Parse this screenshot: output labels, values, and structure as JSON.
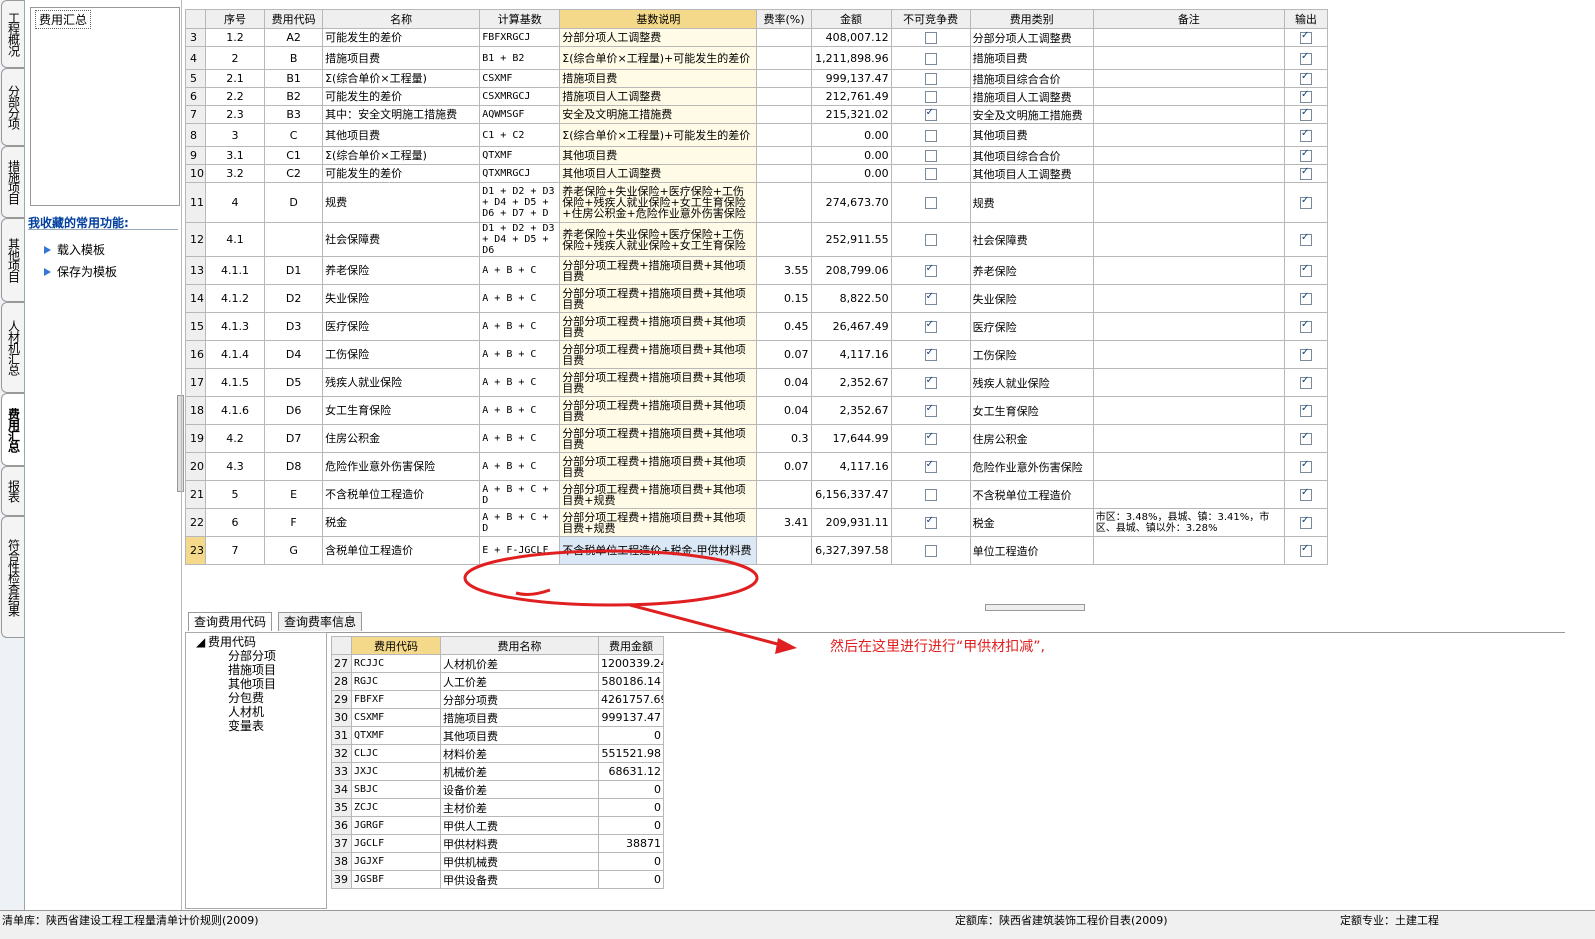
{
  "vertical_tabs": [
    "工程概况",
    "分部分项",
    "措施项目",
    "其他项目",
    "人材机汇总",
    "费用汇总",
    "报表",
    "符合性检查结果"
  ],
  "active_vertical_tab": "费用汇总",
  "nav": {
    "selected": "费用汇总"
  },
  "favorites": {
    "title": "我收藏的常用功能:",
    "items": [
      "载入模板",
      "保存为模板"
    ]
  },
  "grid": {
    "headers": [
      "序号",
      "费用代码",
      "名称",
      "计算基数",
      "基数说明",
      "费率(%)",
      "金额",
      "不可竞争费",
      "费用类别",
      "备注",
      "输出"
    ],
    "rows": [
      {
        "rn": "3",
        "seq": "1.2",
        "code": "A2",
        "name": "可能发生的差价",
        "base": "FBFXRGCJ",
        "note": "分部分项人工调整费",
        "rate": "",
        "amount": "408,007.12",
        "nc": false,
        "cat": "分部分项人工调整费",
        "remark": "",
        "out": true
      },
      {
        "rn": "4",
        "seq": "2",
        "code": "B",
        "name": "措施项目费",
        "base": "B1 + B2",
        "note": "Σ(综合单价×工程量)+可能发生的差价",
        "rate": "",
        "amount": "1,211,898.96",
        "nc": false,
        "cat": "措施项目费",
        "remark": "",
        "out": true
      },
      {
        "rn": "5",
        "seq": "2.1",
        "code": "B1",
        "name": "Σ(综合单价×工程量)",
        "base": "CSXMF",
        "note": "措施项目费",
        "rate": "",
        "amount": "999,137.47",
        "nc": false,
        "cat": "措施项目综合合价",
        "remark": "",
        "out": true
      },
      {
        "rn": "6",
        "seq": "2.2",
        "code": "B2",
        "name": "可能发生的差价",
        "base": "CSXMRGCJ",
        "note": "措施项目人工调整费",
        "rate": "",
        "amount": "212,761.49",
        "nc": false,
        "cat": "措施项目人工调整费",
        "remark": "",
        "out": true
      },
      {
        "rn": "7",
        "seq": "2.3",
        "code": "B3",
        "name": "其中：安全文明施工措施费",
        "base": "AQWMSGF",
        "note": "安全及文明施工措施费",
        "rate": "",
        "amount": "215,321.02",
        "nc": true,
        "cat": "安全及文明施工措施费",
        "remark": "",
        "out": true
      },
      {
        "rn": "8",
        "seq": "3",
        "code": "C",
        "name": "其他项目费",
        "base": "C1 + C2",
        "note": "Σ(综合单价×工程量)+可能发生的差价",
        "rate": "",
        "amount": "0.00",
        "nc": false,
        "cat": "其他项目费",
        "remark": "",
        "out": true
      },
      {
        "rn": "9",
        "seq": "3.1",
        "code": "C1",
        "name": "Σ(综合单价×工程量)",
        "base": "QTXMF",
        "note": "其他项目费",
        "rate": "",
        "amount": "0.00",
        "nc": false,
        "cat": "其他项目综合合价",
        "remark": "",
        "out": true
      },
      {
        "rn": "10",
        "seq": "3.2",
        "code": "C2",
        "name": "可能发生的差价",
        "base": "QTXMRGCJ",
        "note": "其他项目人工调整费",
        "rate": "",
        "amount": "0.00",
        "nc": false,
        "cat": "其他项目人工调整费",
        "remark": "",
        "out": true
      },
      {
        "rn": "11",
        "seq": "4",
        "code": "D",
        "name": "规费",
        "base": "D1 + D2 + D3 + D4 + D5 + D6 + D7 + D",
        "note": "养老保险+失业保险+医疗保险+工伤保险+残疾人就业保险+女工生育保险+住房公积金+危险作业意外伤害保险",
        "rate": "",
        "amount": "274,673.70",
        "nc": false,
        "cat": "规费",
        "remark": "",
        "out": true
      },
      {
        "rn": "12",
        "seq": "4.1",
        "code": "",
        "name": "社会保障费",
        "base": "D1 + D2 + D3 + D4 + D5 + D6",
        "note": "养老保险+失业保险+医疗保险+工伤保险+残疾人就业保险+女工生育保险",
        "rate": "",
        "amount": "252,911.55",
        "nc": false,
        "cat": "社会保障费",
        "remark": "",
        "out": true
      },
      {
        "rn": "13",
        "seq": "4.1.1",
        "code": "D1",
        "name": "养老保险",
        "base": "A + B + C",
        "note": "分部分项工程费+措施项目费+其他项目费",
        "rate": "3.55",
        "amount": "208,799.06",
        "nc": true,
        "cat": "养老保险",
        "remark": "",
        "out": true
      },
      {
        "rn": "14",
        "seq": "4.1.2",
        "code": "D2",
        "name": "失业保险",
        "base": "A + B + C",
        "note": "分部分项工程费+措施项目费+其他项目费",
        "rate": "0.15",
        "amount": "8,822.50",
        "nc": true,
        "cat": "失业保险",
        "remark": "",
        "out": true
      },
      {
        "rn": "15",
        "seq": "4.1.3",
        "code": "D3",
        "name": "医疗保险",
        "base": "A + B + C",
        "note": "分部分项工程费+措施项目费+其他项目费",
        "rate": "0.45",
        "amount": "26,467.49",
        "nc": true,
        "cat": "医疗保险",
        "remark": "",
        "out": true
      },
      {
        "rn": "16",
        "seq": "4.1.4",
        "code": "D4",
        "name": "工伤保险",
        "base": "A + B + C",
        "note": "分部分项工程费+措施项目费+其他项目费",
        "rate": "0.07",
        "amount": "4,117.16",
        "nc": true,
        "cat": "工伤保险",
        "remark": "",
        "out": true
      },
      {
        "rn": "17",
        "seq": "4.1.5",
        "code": "D5",
        "name": "残疾人就业保险",
        "base": "A + B + C",
        "note": "分部分项工程费+措施项目费+其他项目费",
        "rate": "0.04",
        "amount": "2,352.67",
        "nc": true,
        "cat": "残疾人就业保险",
        "remark": "",
        "out": true
      },
      {
        "rn": "18",
        "seq": "4.1.6",
        "code": "D6",
        "name": "女工生育保险",
        "base": "A + B + C",
        "note": "分部分项工程费+措施项目费+其他项目费",
        "rate": "0.04",
        "amount": "2,352.67",
        "nc": true,
        "cat": "女工生育保险",
        "remark": "",
        "out": true
      },
      {
        "rn": "19",
        "seq": "4.2",
        "code": "D7",
        "name": "住房公积金",
        "base": "A + B + C",
        "note": "分部分项工程费+措施项目费+其他项目费",
        "rate": "0.3",
        "amount": "17,644.99",
        "nc": true,
        "cat": "住房公积金",
        "remark": "",
        "out": true
      },
      {
        "rn": "20",
        "seq": "4.3",
        "code": "D8",
        "name": "危险作业意外伤害保险",
        "base": "A + B + C",
        "note": "分部分项工程费+措施项目费+其他项目费",
        "rate": "0.07",
        "amount": "4,117.16",
        "nc": true,
        "cat": "危险作业意外伤害保险",
        "remark": "",
        "out": true
      },
      {
        "rn": "21",
        "seq": "5",
        "code": "E",
        "name": "不含税单位工程造价",
        "base": "A + B + C + D",
        "note": "分部分项工程费+措施项目费+其他项目费+规费",
        "rate": "",
        "amount": "6,156,337.47",
        "nc": false,
        "cat": "不含税单位工程造价",
        "remark": "",
        "out": true
      },
      {
        "rn": "22",
        "seq": "6",
        "code": "F",
        "name": "税金",
        "base": "A + B + C + D",
        "note": "分部分项工程费+措施项目费+其他项目费+规费",
        "rate": "3.41",
        "amount": "209,931.11",
        "nc": true,
        "cat": "税金",
        "remark": "市区：3.48%，县城、镇：3.41%，市区、县城、镇以外：3.28%",
        "out": true
      },
      {
        "rn": "23",
        "seq": "7",
        "code": "G",
        "name": "含税单位工程造价",
        "base": "E + F-JGCLF",
        "note": "不含税单位工程造价+税金-甲供材料费",
        "rate": "",
        "amount": "6,327,397.58",
        "nc": false,
        "cat": "单位工程造价",
        "remark": "",
        "out": true,
        "selected": true
      }
    ]
  },
  "bottom_tabs": [
    "查询费用代码",
    "查询费率信息"
  ],
  "tree": {
    "root": "费用代码",
    "children": [
      "分部分项",
      "措施项目",
      "其他项目",
      "分包费",
      "人材机",
      "变量表"
    ]
  },
  "codes": {
    "headers": [
      "费用代码",
      "费用名称",
      "费用金额"
    ],
    "rows": [
      {
        "rn": "27",
        "code": "RCJJC",
        "name": "人材机价差",
        "amount": "1200339.24"
      },
      {
        "rn": "28",
        "code": "RGJC",
        "name": "人工价差",
        "amount": "580186.14"
      },
      {
        "rn": "29",
        "code": "FBFXF",
        "name": "分部分项费",
        "amount": "4261757.69"
      },
      {
        "rn": "30",
        "code": "CSXMF",
        "name": "措施项目费",
        "amount": "999137.47"
      },
      {
        "rn": "31",
        "code": "QTXMF",
        "name": "其他项目费",
        "amount": "0"
      },
      {
        "rn": "32",
        "code": "CLJC",
        "name": "材料价差",
        "amount": "551521.98"
      },
      {
        "rn": "33",
        "code": "JXJC",
        "name": "机械价差",
        "amount": "68631.12"
      },
      {
        "rn": "34",
        "code": "SBJC",
        "name": "设备价差",
        "amount": "0"
      },
      {
        "rn": "35",
        "code": "ZCJC",
        "name": "主材价差",
        "amount": "0"
      },
      {
        "rn": "36",
        "code": "JGRGF",
        "name": "甲供人工费",
        "amount": "0"
      },
      {
        "rn": "37",
        "code": "JGCLF",
        "name": "甲供材料费",
        "amount": "38871"
      },
      {
        "rn": "38",
        "code": "JGJXF",
        "name": "甲供机械费",
        "amount": "0"
      },
      {
        "rn": "39",
        "code": "JGSBF",
        "name": "甲供设备费",
        "amount": "0"
      }
    ]
  },
  "annotation": {
    "text": "然后在这里进行进行“甲供材扣减”,",
    "color": "#e02020"
  },
  "status": {
    "left": "清单库：陕西省建设工程工程量清单计价规则(2009)",
    "mid": "定额库：陕西省建筑装饰工程价目表(2009)",
    "right": "定额专业：土建工程"
  }
}
